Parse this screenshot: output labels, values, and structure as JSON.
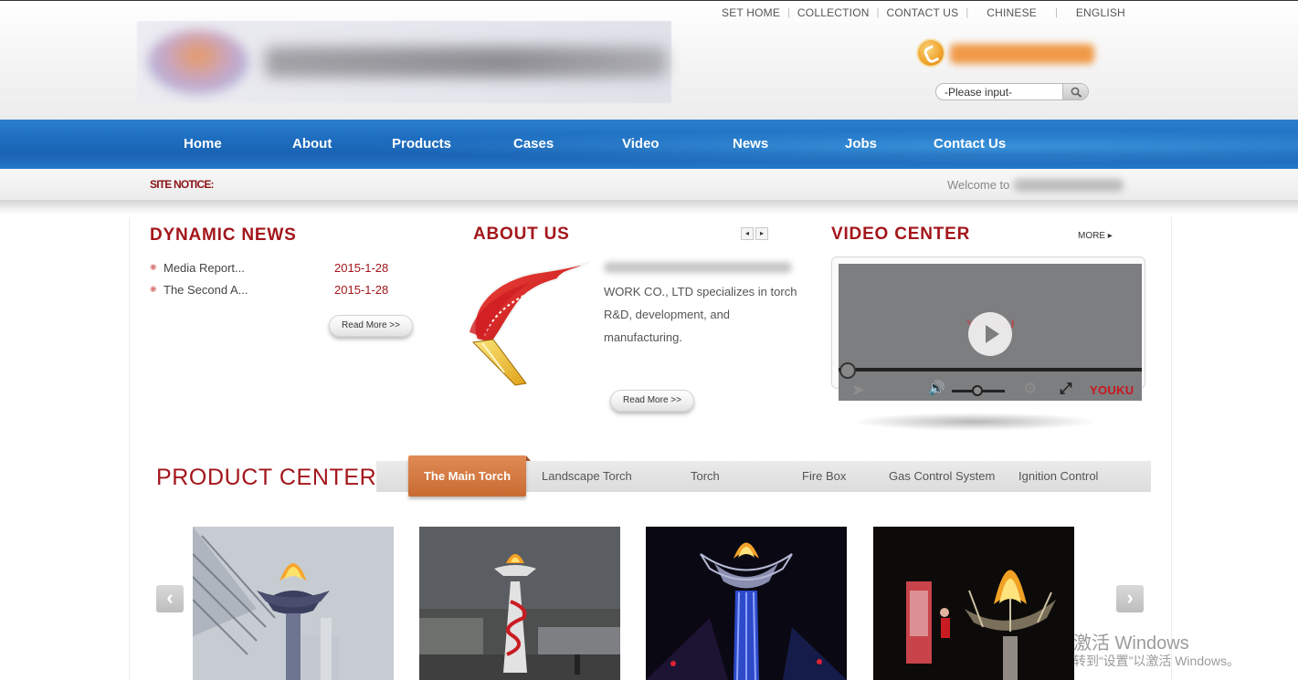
{
  "header": {
    "top_links": [
      "SET HOME",
      "COLLECTION",
      "CONTACT US",
      "CHINESE",
      "ENGLISH"
    ],
    "search_placeholder": "-Please input-"
  },
  "nav": {
    "items": [
      "Home",
      "About",
      "Products",
      "Cases",
      "Video",
      "News",
      "Jobs",
      "Contact Us"
    ]
  },
  "notice": {
    "label": "SITE NOTICE:",
    "text": "Welcome to"
  },
  "dynamic_news": {
    "title": "DYNAMIC NEWS",
    "items": [
      {
        "title": "Media Report...",
        "date": "2015-1-28"
      },
      {
        "title": "The Second A...",
        "date": "2015-1-28"
      }
    ],
    "read_more": "Read More >>"
  },
  "about": {
    "title": "ABOUT US",
    "prev": "◂",
    "next": "▸",
    "text": "WORK CO., LTD specializes in torch R&D, development, and manufacturing.",
    "read_more": "Read More >>"
  },
  "video": {
    "title": "VIDEO CENTER",
    "more": "MORE ▸",
    "brand": "YOUKU",
    "brand_center": "YOUKU"
  },
  "products": {
    "title": "PRODUCT CENTER",
    "tabs": [
      "The Main Torch",
      "Landscape Torch",
      "Torch",
      "Fire Box",
      "Gas Control System",
      "Ignition Control"
    ],
    "active_tab": "The Main Torch"
  },
  "watermark": {
    "line1": "激活 Windows",
    "line2": "转到“设置”以激活 Windows。"
  },
  "colors": {
    "accent_red": "#a3161b",
    "nav_blue": "#1f6fc1",
    "active_tab_orange": "#d57840"
  }
}
